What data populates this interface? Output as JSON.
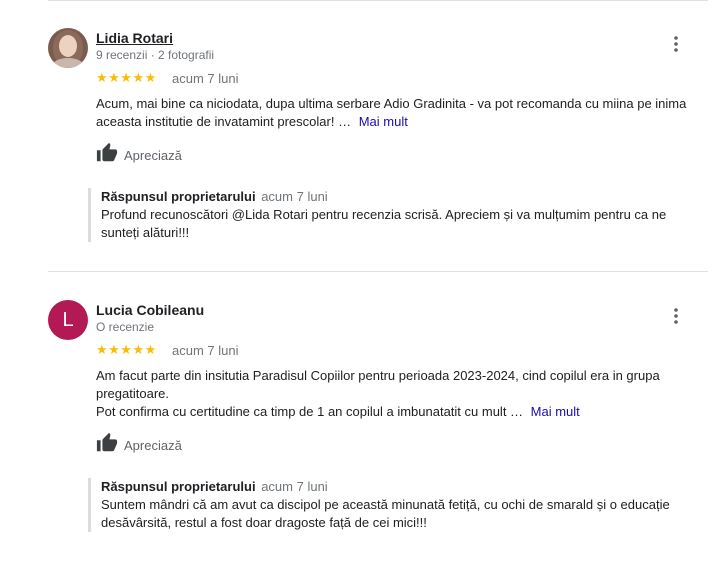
{
  "reviews": [
    {
      "name": "Lidia Rotari",
      "meta": "9 recenzii · 2 fotografii",
      "stars": "★★★★★",
      "rating": 5,
      "date": "acum 7 luni",
      "text": "Acum, mai bine ca niciodata, dupa ultima serbare Adio Gradinita - va pot recomanda cu miina pe inima aceasta institutie de invatamint prescolar! …",
      "more": "Mai mult",
      "like": "Apreciază",
      "reply": {
        "title": "Răspunsul proprietarului",
        "date": "acum 7 luni",
        "text": "Profund recunoscători @Lida Rotari pentru recenzia scrisă. Apreciem și va mulțumim pentru ca ne sunteți alături!!!"
      }
    },
    {
      "name": "Lucia Cobileanu",
      "avatar_letter": "L",
      "meta": "O recenzie",
      "stars": "★★★★★",
      "rating": 5,
      "date": "acum 7 luni",
      "text_line1": "Am facut parte din insitutia Paradisul Copiilor pentru perioada 2023-2024, cind copilul era in grupa pregatitoare.",
      "text_line2": "Pot confirma cu certitudine ca timp de 1 an copilul a imbunatatit cu mult …",
      "more": "Mai mult",
      "like": "Apreciază",
      "reply": {
        "title": "Răspunsul proprietarului",
        "date": "acum 7 luni",
        "text": "Suntem mândri că am avut ca discipol pe această minunată fetiță, cu ochi de smarald și o educație desăvârsită, restul a fost doar dragoste față de cei mici!!!"
      }
    }
  ],
  "colors": {
    "star": "#fbbc04",
    "link": "#1a0dab",
    "avatar_l": "#b31954"
  },
  "icons": [
    "more-vert-icon",
    "thumbs-up-icon",
    "star-icon"
  ]
}
